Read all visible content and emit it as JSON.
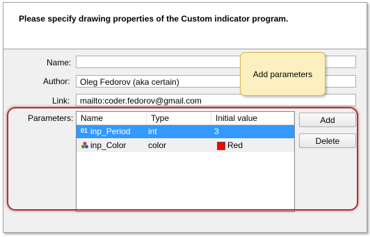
{
  "dialog": {
    "header_text": "Please specify drawing properties of the Custom indicator program."
  },
  "form": {
    "name_label": "Name:",
    "name_value": "",
    "author_label": "Author:",
    "author_value": "Oleg Fedorov (aka certain)",
    "link_label": "Link:",
    "link_value": "mailto:coder.fedorov@gmail.com",
    "parameters_label": "Parameters:"
  },
  "table": {
    "columns": [
      "Name",
      "Type",
      "Initial value"
    ],
    "rows": [
      {
        "icon": "integer-param-icon",
        "icon_text": "01",
        "name": "inp_Period",
        "type": "int",
        "value": "3",
        "selected": true
      },
      {
        "icon": "color-param-icon",
        "icon_text": "",
        "name": "inp_Color",
        "type": "color",
        "value": "Red",
        "swatch": "#ff0000",
        "selected": false
      }
    ]
  },
  "buttons": {
    "add": "Add",
    "delete": "Delete"
  },
  "tooltip": {
    "text": "Add parameters"
  }
}
